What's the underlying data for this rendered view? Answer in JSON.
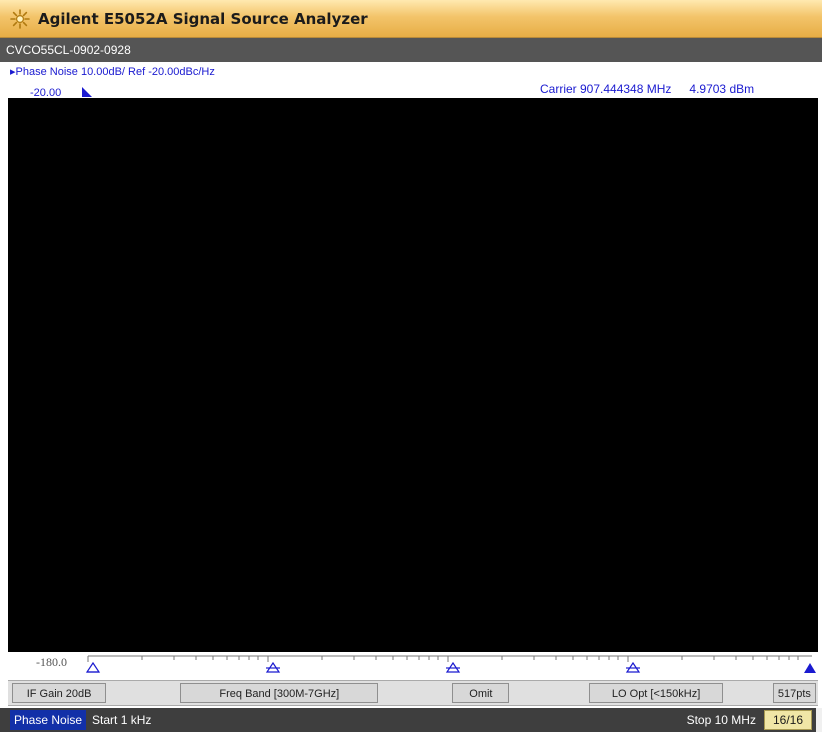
{
  "app": {
    "title": "Agilent E5052A Signal Source Analyzer",
    "icon": "sun-icon",
    "title_bar_color": "#f3c46a"
  },
  "channel": {
    "label": "CVCO55CL-0902-0928"
  },
  "trace": {
    "label": "▸Phase Noise 10.00dB/ Ref -20.00dBc/Hz",
    "y_top": "-20.00",
    "y_bottom": "-180.0",
    "carrier_label": "Carrier 907.444348 MHz",
    "carrier_power": "4.9703 dBm",
    "color": "#1a1ad0"
  },
  "settings_bar": {
    "if_gain": "IF Gain 20dB",
    "freq_band": "Freq Band [300M-7GHz]",
    "omit": "Omit",
    "lo_opt": "LO Opt [<150kHz]",
    "points": "517pts"
  },
  "status_bar": {
    "measurement": "Phase Noise",
    "start": "Start 1 kHz",
    "stop": "Stop 10 MHz",
    "average_count": "16/16",
    "measurement_color": "#1230a8"
  }
}
